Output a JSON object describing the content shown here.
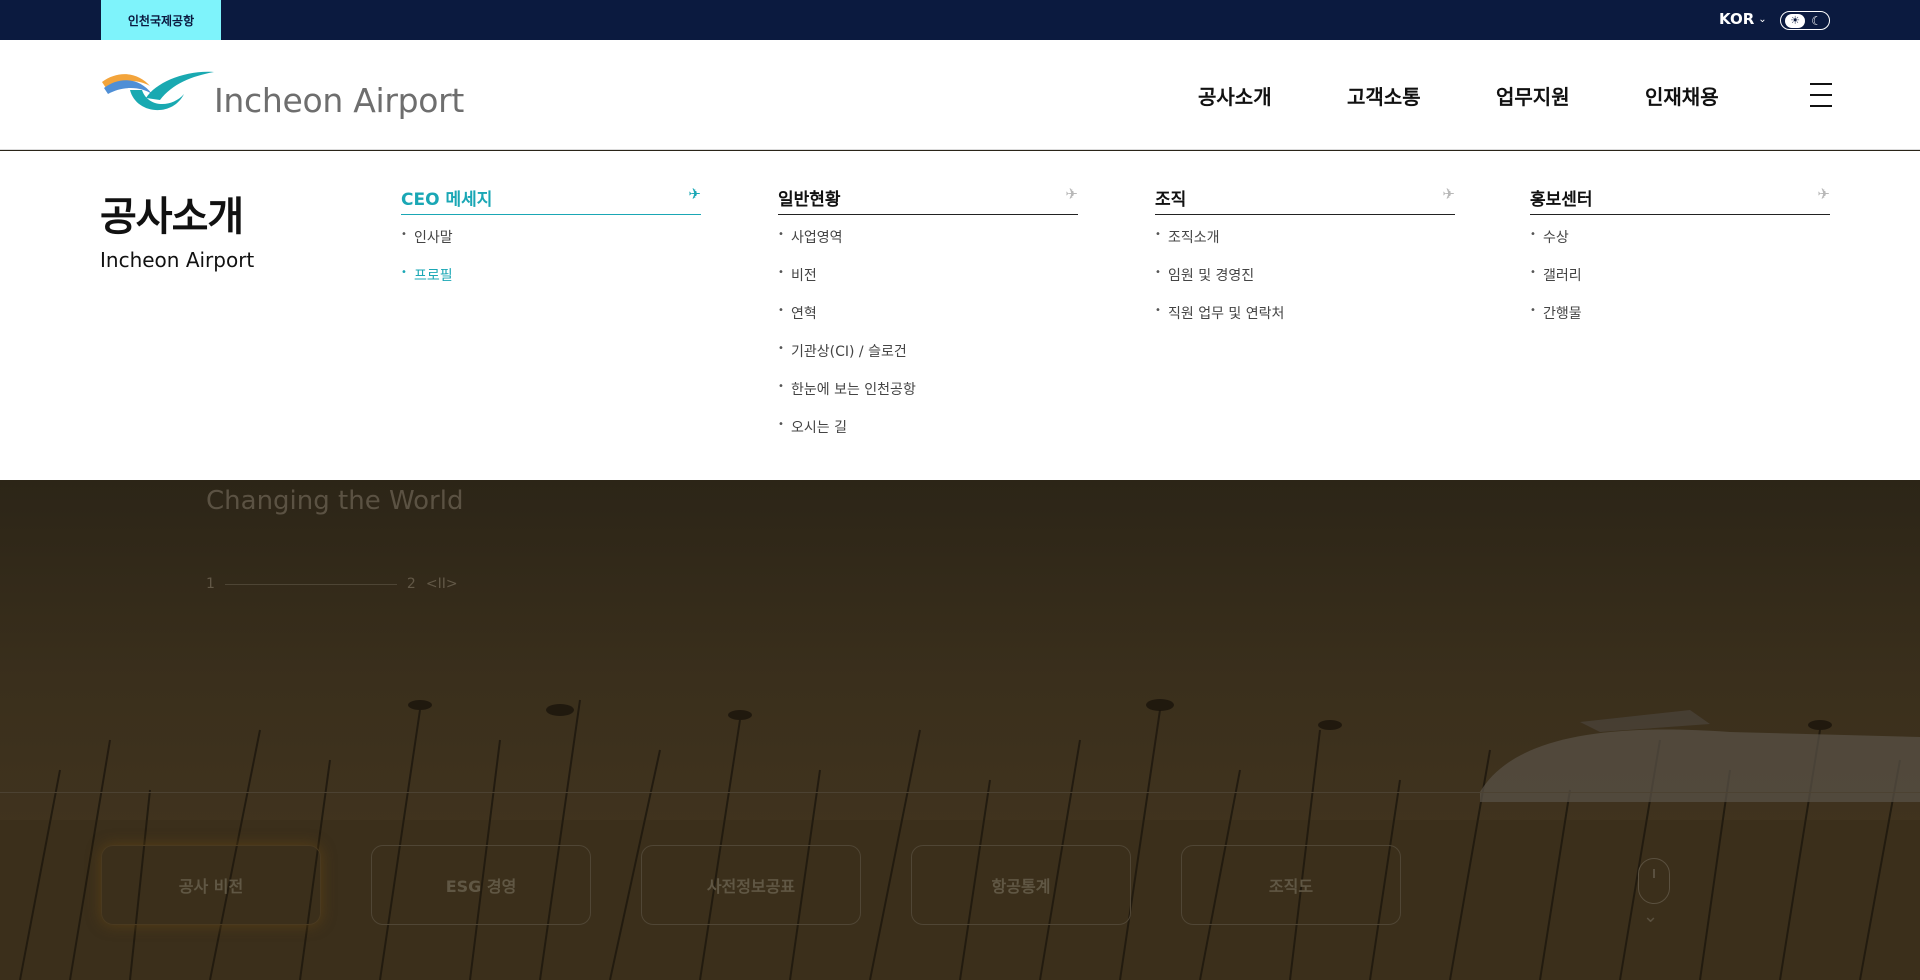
{
  "topbar": {
    "home_tab": "인천국제공항",
    "language": "KOR",
    "theme_toggle": {
      "light_icon": "sun-icon",
      "dark_icon": "moon-icon"
    }
  },
  "header": {
    "logo_text": "Incheon Airport",
    "nav": [
      {
        "label": "공사소개"
      },
      {
        "label": "고객소통"
      },
      {
        "label": "업무지원"
      },
      {
        "label": "인재채용"
      }
    ],
    "menu_icon": "hamburger-icon"
  },
  "mega_menu": {
    "title": "공사소개",
    "subtitle": "Incheon Airport",
    "accent_color": "#1aa7b5",
    "columns": [
      {
        "heading": "CEO 메세지",
        "active": true,
        "items": [
          {
            "label": "인사말",
            "active": false
          },
          {
            "label": "프로필",
            "active": true
          }
        ]
      },
      {
        "heading": "일반현황",
        "active": false,
        "items": [
          {
            "label": "사업영역"
          },
          {
            "label": "비전"
          },
          {
            "label": "연혁"
          },
          {
            "label": "기관상(CI) / 슬로건"
          },
          {
            "label": "한눈에 보는 인천공항"
          },
          {
            "label": "오시는 길"
          }
        ]
      },
      {
        "heading": "조직",
        "active": false,
        "items": [
          {
            "label": "조직소개"
          },
          {
            "label": "임원 및 경영진"
          },
          {
            "label": "직원 업무 및 연락처"
          }
        ]
      },
      {
        "heading": "홍보센터",
        "active": false,
        "items": [
          {
            "label": "수상"
          },
          {
            "label": "갤러리"
          },
          {
            "label": "간행물"
          }
        ]
      }
    ]
  },
  "hero": {
    "title_line": "Changing the World",
    "pager": {
      "current": "1",
      "total": "2",
      "controls": "<II>"
    },
    "quick_links": [
      {
        "label": "공사 비전"
      },
      {
        "label": "ESG 경영"
      },
      {
        "label": "사전정보공표"
      },
      {
        "label": "항공통계"
      },
      {
        "label": "조직도"
      }
    ]
  },
  "colors": {
    "topbar_bg": "#0b1a3f",
    "home_tab_bg": "#7ef3fb",
    "logo_teal": "#19a9b1",
    "logo_orange": "#f3a43b"
  }
}
